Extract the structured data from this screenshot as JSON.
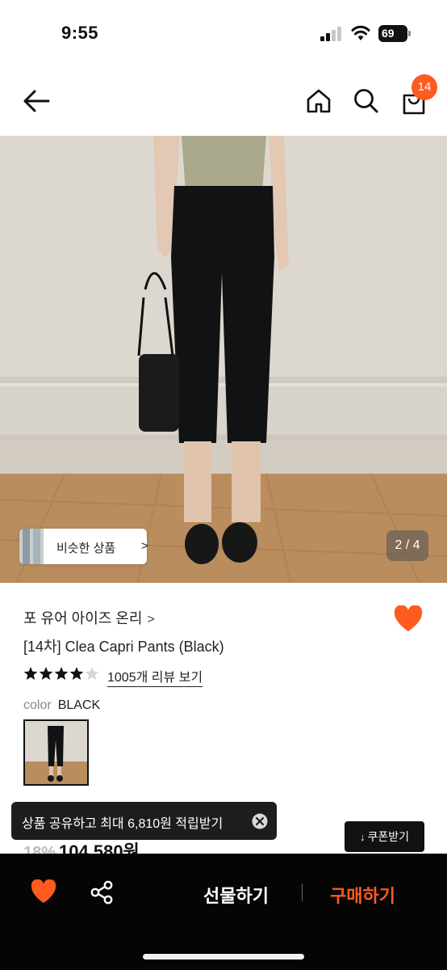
{
  "status_bar": {
    "time": "9:55",
    "battery": "69"
  },
  "header": {
    "icons": [
      "back-arrow-icon",
      "home-icon",
      "search-icon",
      "shopping-bag-icon"
    ],
    "cart_count": "14",
    "accent_color": "#ff5a1f"
  },
  "gallery": {
    "similar_label": "비슷한 상품",
    "similar_chevron": ">",
    "counter": "2 / 4"
  },
  "product": {
    "brand": "포 유어 아이즈 온리",
    "brand_chevron": ">",
    "title": "[14차] Clea Capri Pants (Black)",
    "rating_stars": 4.5,
    "review_link": "1005개 리뷰 보기",
    "color_label": "color",
    "color_value": "BLACK",
    "discount": "18%",
    "price": "104,580원"
  },
  "toast": {
    "text": "상품 공유하고 최대 6,810원 적립받기"
  },
  "coupon": {
    "label": "쿠폰받기",
    "arrow": "↓"
  },
  "bottom_bar": {
    "gift_label": "선물하기",
    "buy_label": "구매하기",
    "buy_color": "#ff5a1f"
  }
}
